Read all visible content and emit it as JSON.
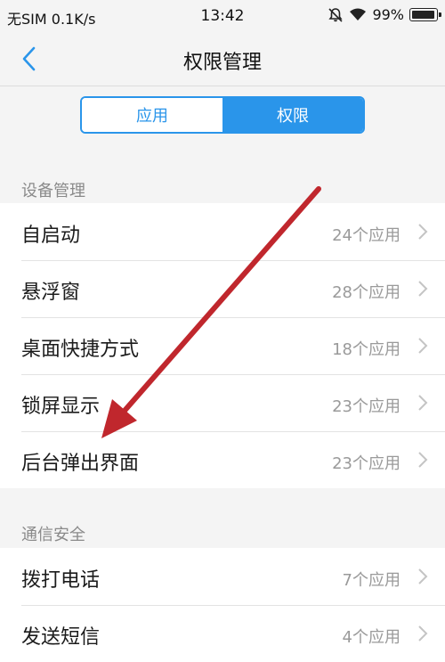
{
  "status_bar": {
    "carrier": "无SIM",
    "speed": "0.1K/s",
    "time": "13:42",
    "battery": "99%",
    "battery_level": 0.99
  },
  "nav": {
    "title": "权限管理"
  },
  "segments": {
    "apps": "应用",
    "permissions": "权限",
    "active": "permissions"
  },
  "sections": [
    {
      "header": "设备管理",
      "items": [
        {
          "label": "自启动",
          "value": "24个应用"
        },
        {
          "label": "悬浮窗",
          "value": "28个应用"
        },
        {
          "label": "桌面快捷方式",
          "value": "18个应用"
        },
        {
          "label": "锁屏显示",
          "value": "23个应用"
        },
        {
          "label": "后台弹出界面",
          "value": "23个应用"
        }
      ]
    },
    {
      "header": "通信安全",
      "items": [
        {
          "label": "拨打电话",
          "value": "7个应用"
        },
        {
          "label": "发送短信",
          "value": "4个应用"
        }
      ]
    }
  ],
  "colors": {
    "accent": "#2a95ea",
    "annotation_arrow": "#c0272d"
  }
}
